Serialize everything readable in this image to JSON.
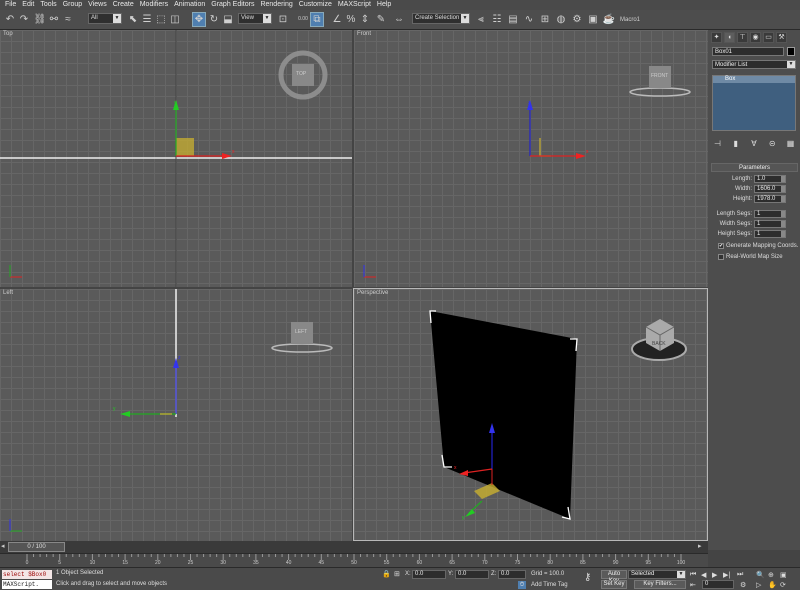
{
  "menu": [
    "File",
    "Edit",
    "Tools",
    "Group",
    "Views",
    "Create",
    "Modifiers",
    "Animation",
    "Graph Editors",
    "Rendering",
    "Customize",
    "MAXScript",
    "Help"
  ],
  "toolbar": {
    "undo_icon": "undo-arrow",
    "redo_icon": "redo-arrow",
    "selection_filter": "All",
    "reference_coord": "View",
    "snap_percent": "0.00",
    "named_selection": "Create Selection Se",
    "macro": "Macro1"
  },
  "viewports": {
    "top": "Top",
    "front": "Front",
    "left": "Left",
    "perspective": "Perspective",
    "viewcube_top": "TOP",
    "viewcube_front": "FRONT",
    "viewcube_left": "LEFT",
    "viewcube_persp": "BACK"
  },
  "axes": {
    "x": "x",
    "y": "y",
    "z": "z"
  },
  "command_panel": {
    "object_name": "Box01",
    "object_color": "#000000",
    "modifier_list": "Modifier List",
    "stack_item": "Box",
    "rollout_title": "Parameters",
    "params": [
      {
        "label": "Length:",
        "value": "1.0"
      },
      {
        "label": "Width:",
        "value": "1606.0"
      },
      {
        "label": "Height:",
        "value": "1978.0"
      }
    ],
    "segs": [
      {
        "label": "Length Segs:",
        "value": "1"
      },
      {
        "label": "Width Segs:",
        "value": "1"
      },
      {
        "label": "Height Segs:",
        "value": "1"
      }
    ],
    "gen_mapping": "Generate Mapping Coords.",
    "gen_mapping_checked": true,
    "real_world": "Real-World Map Size",
    "real_world_checked": false
  },
  "timeline": {
    "slider": "0 / 100",
    "ticks": [
      "0",
      "5",
      "10",
      "15",
      "20",
      "25",
      "30",
      "35",
      "40",
      "45",
      "50",
      "55",
      "60",
      "65",
      "70",
      "75",
      "80",
      "85",
      "90",
      "95",
      "100"
    ]
  },
  "status": {
    "listener_cmd": "select $Box0",
    "listener_out": "MAXScript.",
    "selected_msg": "1 Object Selected",
    "prompt": "Click and drag to select and move objects",
    "x_label": "X:",
    "x_value": "0.0",
    "y_label": "Y:",
    "y_value": "0.0",
    "z_label": "Z:",
    "z_value": "0.0",
    "grid": "Grid = 100.0",
    "add_time_tag": "Add Time Tag",
    "auto_key": "Auto Key",
    "set_key": "Set Key",
    "key_mode": "Selected",
    "key_filters": "Key Filters...",
    "frame": "0"
  }
}
